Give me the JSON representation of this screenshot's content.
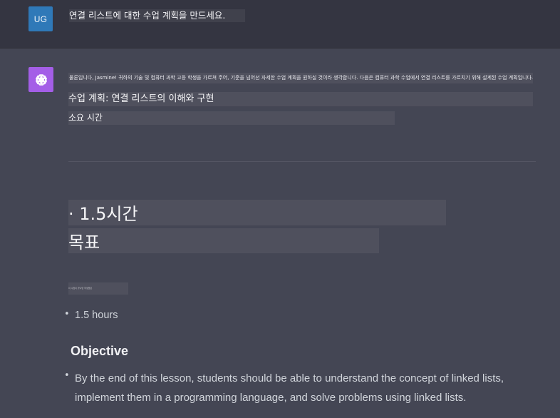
{
  "user": {
    "avatar_initials": "UG",
    "message": "연결 리스트에 대한 수업 계획을 만드세요."
  },
  "assistant": {
    "avatar_icon": "openai-logo-icon",
    "intro": "물론입니다, Jasmine! 귀하의 기술 및 컴퓨터 과학 고등 학생을 가르쳐 주어, 기준을 넘어선 자세한 수업 계획을 원하실 것이라 생각합니다. 다음은 컴퓨터 과학 수업에서 연결 리스트를 가르치기 위해 설계된 수업 계획입니다.",
    "heading_plan": "수업 계획: 연결 리스트의 이해와 구현",
    "heading_duration": "소요 시간",
    "big_duration": "· 1.5시간",
    "big_objective": "목표",
    "tiny_text": "이 수업이 끝나면 학생들은",
    "duration_item": "1.5 hours",
    "objective_heading": "Objective",
    "objective_text": "By the end of this lesson, students should be able to understand the concept of linked lists, implement them in a programming language, and solve problems using linked lists."
  },
  "colors": {
    "page_bg": "#444654",
    "user_row_bg": "#343541",
    "user_avatar": "#2f79b8",
    "bot_avatar": "#a45ee7",
    "highlight": "#4f505d"
  }
}
